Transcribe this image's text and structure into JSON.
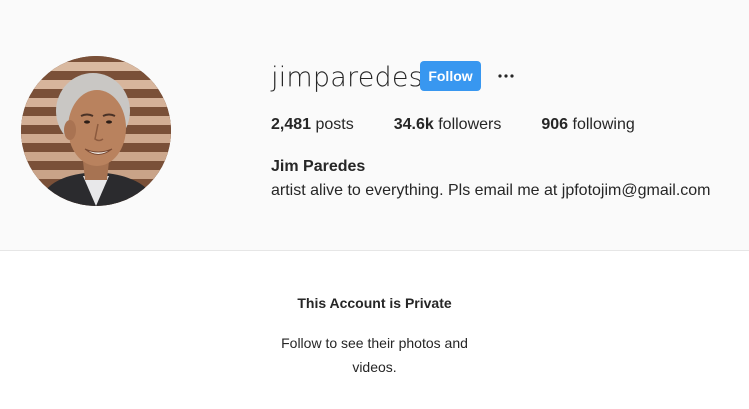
{
  "profile": {
    "username": "jimparedes",
    "follow_label": "Follow",
    "more_label": "•••",
    "full_name": "Jim Paredes",
    "bio": "artist alive to everything. Pls email me at jpfotojim@gmail.com",
    "stats": {
      "posts_count": "2,481",
      "posts_label": " posts",
      "followers_count": "34.6k",
      "followers_label": " followers",
      "following_count": "906",
      "following_label": " following"
    }
  },
  "private_notice": {
    "title": "This Account is Private",
    "text": "Follow to see their photos and videos."
  },
  "colors": {
    "follow_button": "#3897f0",
    "header_bg": "#fafafa",
    "text": "#262626"
  }
}
